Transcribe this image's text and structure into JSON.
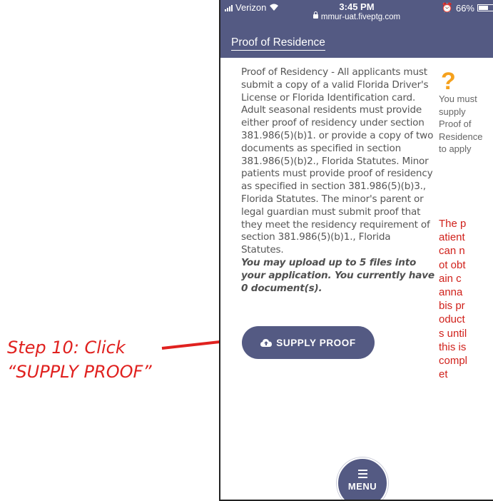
{
  "annotation": {
    "line1": "Step 10: Click",
    "line2": "“SUPPLY PROOF”",
    "color": "#e0211f"
  },
  "status_bar": {
    "carrier": "Verizon",
    "time": "3:45 PM",
    "url": "mmur-uat.fiveptg.com",
    "battery": "66%"
  },
  "header": {
    "title": "Proof of Residence",
    "bg_color": "#545a83"
  },
  "main": {
    "description": "Proof of Residency - All applicants must submit a copy of a valid Florida Driver's License or Florida Identification card. Adult seasonal residents must provide either proof of residency under section 381.986(5)(b)1. or provide a copy of two documents as specified in section 381.986(5)(b)2., Florida Statutes. Minor patients must provide proof of residency as specified in section 381.986(5)(b)3., Florida Statutes. The minor's parent or legal guardian must submit proof that they meet the residency requirement of section 381.986(5)(b)1., Florida Statutes.",
    "upload_note": "You may upload up to 5 files into your application. You currently have 0 document(s).",
    "supply_button": "SUPPLY PROOF"
  },
  "help": {
    "icon": "question-mark-icon",
    "message": "You must supply Proof of Residence to apply",
    "warning": "The patient can not obtain cannabis products until this is complet",
    "warning_color": "#d0211b"
  },
  "menu": {
    "label": "MENU"
  }
}
